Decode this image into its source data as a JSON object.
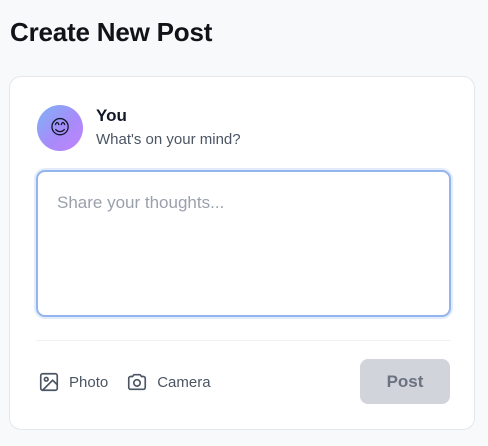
{
  "page": {
    "title": "Create New Post"
  },
  "author": {
    "avatar_emoji": "😊",
    "name": "You",
    "prompt": "What's on your mind?"
  },
  "composer": {
    "placeholder": "Share your thoughts...",
    "value": ""
  },
  "actions": {
    "photo": {
      "label": "Photo",
      "icon": "image-icon"
    },
    "camera": {
      "label": "Camera",
      "icon": "camera-icon"
    }
  },
  "submit": {
    "label": "Post",
    "state": "disabled"
  },
  "colors": {
    "focus_border": "#93b4ee",
    "button_disabled_bg": "#d1d5db",
    "button_disabled_text": "#6b7280"
  }
}
